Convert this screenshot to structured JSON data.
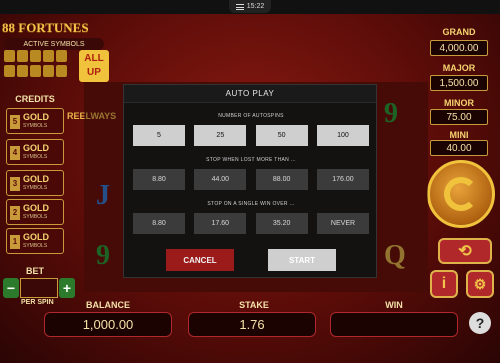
{
  "status_bar": {
    "time": "15:22"
  },
  "logo": {
    "text": "88 FORTUNES",
    "active_symbols": "ACTIVE SYMBOLS",
    "all_up": "ALL UP"
  },
  "credits": {
    "title": "CREDITS",
    "items": [
      {
        "num": "5",
        "label": "GOLD",
        "sub": "SYMBOLS"
      },
      {
        "num": "4",
        "label": "GOLD",
        "sub": "SYMBOLS"
      },
      {
        "num": "3",
        "label": "GOLD",
        "sub": "SYMBOLS"
      },
      {
        "num": "2",
        "label": "GOLD",
        "sub": "SYMBOLS"
      },
      {
        "num": "1",
        "label": "GOLD",
        "sub": "SYMBOLS"
      }
    ]
  },
  "reels_text": "REELWAYS",
  "bet": {
    "label": "BET",
    "minus": "−",
    "plus": "+",
    "per_spin": "PER SPIN"
  },
  "bottom": {
    "balance_label": "BALANCE",
    "balance_value": "1,000.00",
    "stake_label": "STAKE",
    "stake_value": "1.76",
    "win_label": "WIN",
    "win_value": ""
  },
  "jackpots": [
    {
      "label": "GRAND",
      "value": "4,000.00"
    },
    {
      "label": "MAJOR",
      "value": "1,500.00"
    },
    {
      "label": "MINOR",
      "value": "75.00"
    },
    {
      "label": "MINI",
      "value": "40.00"
    }
  ],
  "help": "?",
  "info": "i",
  "modal": {
    "title": "AUTO PLAY",
    "autospins_label": "NUMBER OF AUTOSPINS",
    "autospins": [
      "5",
      "25",
      "50",
      "100"
    ],
    "loss_label": "STOP WHEN LOST MORE THAN ...",
    "loss_options": [
      "8.80",
      "44.00",
      "88.00",
      "176.00"
    ],
    "win_label": "STOP ON A SINGLE WIN OVER ...",
    "win_options": [
      "8.80",
      "17.60",
      "35.20",
      "NEVER"
    ],
    "cancel": "CANCEL",
    "start": "START"
  },
  "colors": {
    "accent_red": "#9b1b1b",
    "gold": "#f1c33d",
    "background": "#5a0c08"
  }
}
